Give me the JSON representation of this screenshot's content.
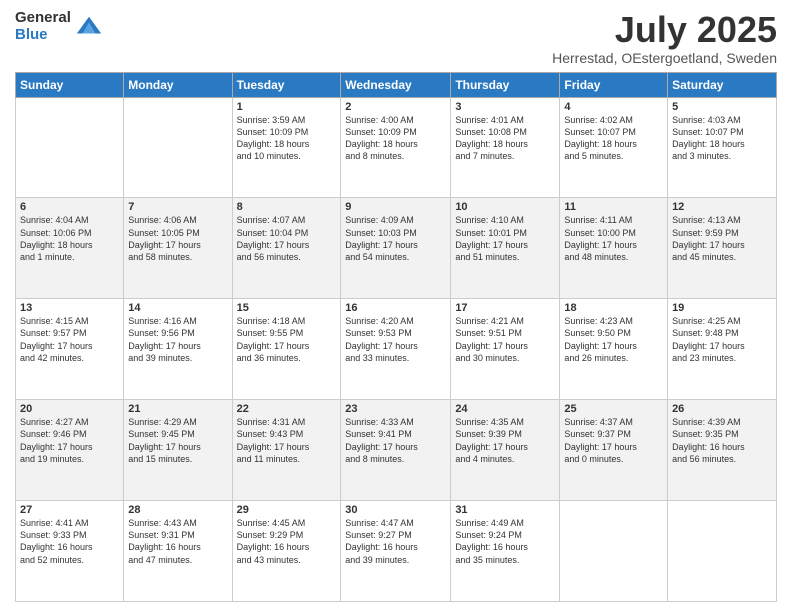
{
  "header": {
    "logo_general": "General",
    "logo_blue": "Blue",
    "title": "July 2025",
    "subtitle": "Herrestad, OEstergoetland, Sweden"
  },
  "days_of_week": [
    "Sunday",
    "Monday",
    "Tuesday",
    "Wednesday",
    "Thursday",
    "Friday",
    "Saturday"
  ],
  "weeks": [
    [
      {
        "day": "",
        "info": ""
      },
      {
        "day": "",
        "info": ""
      },
      {
        "day": "1",
        "info": "Sunrise: 3:59 AM\nSunset: 10:09 PM\nDaylight: 18 hours\nand 10 minutes."
      },
      {
        "day": "2",
        "info": "Sunrise: 4:00 AM\nSunset: 10:09 PM\nDaylight: 18 hours\nand 8 minutes."
      },
      {
        "day": "3",
        "info": "Sunrise: 4:01 AM\nSunset: 10:08 PM\nDaylight: 18 hours\nand 7 minutes."
      },
      {
        "day": "4",
        "info": "Sunrise: 4:02 AM\nSunset: 10:07 PM\nDaylight: 18 hours\nand 5 minutes."
      },
      {
        "day": "5",
        "info": "Sunrise: 4:03 AM\nSunset: 10:07 PM\nDaylight: 18 hours\nand 3 minutes."
      }
    ],
    [
      {
        "day": "6",
        "info": "Sunrise: 4:04 AM\nSunset: 10:06 PM\nDaylight: 18 hours\nand 1 minute."
      },
      {
        "day": "7",
        "info": "Sunrise: 4:06 AM\nSunset: 10:05 PM\nDaylight: 17 hours\nand 58 minutes."
      },
      {
        "day": "8",
        "info": "Sunrise: 4:07 AM\nSunset: 10:04 PM\nDaylight: 17 hours\nand 56 minutes."
      },
      {
        "day": "9",
        "info": "Sunrise: 4:09 AM\nSunset: 10:03 PM\nDaylight: 17 hours\nand 54 minutes."
      },
      {
        "day": "10",
        "info": "Sunrise: 4:10 AM\nSunset: 10:01 PM\nDaylight: 17 hours\nand 51 minutes."
      },
      {
        "day": "11",
        "info": "Sunrise: 4:11 AM\nSunset: 10:00 PM\nDaylight: 17 hours\nand 48 minutes."
      },
      {
        "day": "12",
        "info": "Sunrise: 4:13 AM\nSunset: 9:59 PM\nDaylight: 17 hours\nand 45 minutes."
      }
    ],
    [
      {
        "day": "13",
        "info": "Sunrise: 4:15 AM\nSunset: 9:57 PM\nDaylight: 17 hours\nand 42 minutes."
      },
      {
        "day": "14",
        "info": "Sunrise: 4:16 AM\nSunset: 9:56 PM\nDaylight: 17 hours\nand 39 minutes."
      },
      {
        "day": "15",
        "info": "Sunrise: 4:18 AM\nSunset: 9:55 PM\nDaylight: 17 hours\nand 36 minutes."
      },
      {
        "day": "16",
        "info": "Sunrise: 4:20 AM\nSunset: 9:53 PM\nDaylight: 17 hours\nand 33 minutes."
      },
      {
        "day": "17",
        "info": "Sunrise: 4:21 AM\nSunset: 9:51 PM\nDaylight: 17 hours\nand 30 minutes."
      },
      {
        "day": "18",
        "info": "Sunrise: 4:23 AM\nSunset: 9:50 PM\nDaylight: 17 hours\nand 26 minutes."
      },
      {
        "day": "19",
        "info": "Sunrise: 4:25 AM\nSunset: 9:48 PM\nDaylight: 17 hours\nand 23 minutes."
      }
    ],
    [
      {
        "day": "20",
        "info": "Sunrise: 4:27 AM\nSunset: 9:46 PM\nDaylight: 17 hours\nand 19 minutes."
      },
      {
        "day": "21",
        "info": "Sunrise: 4:29 AM\nSunset: 9:45 PM\nDaylight: 17 hours\nand 15 minutes."
      },
      {
        "day": "22",
        "info": "Sunrise: 4:31 AM\nSunset: 9:43 PM\nDaylight: 17 hours\nand 11 minutes."
      },
      {
        "day": "23",
        "info": "Sunrise: 4:33 AM\nSunset: 9:41 PM\nDaylight: 17 hours\nand 8 minutes."
      },
      {
        "day": "24",
        "info": "Sunrise: 4:35 AM\nSunset: 9:39 PM\nDaylight: 17 hours\nand 4 minutes."
      },
      {
        "day": "25",
        "info": "Sunrise: 4:37 AM\nSunset: 9:37 PM\nDaylight: 17 hours\nand 0 minutes."
      },
      {
        "day": "26",
        "info": "Sunrise: 4:39 AM\nSunset: 9:35 PM\nDaylight: 16 hours\nand 56 minutes."
      }
    ],
    [
      {
        "day": "27",
        "info": "Sunrise: 4:41 AM\nSunset: 9:33 PM\nDaylight: 16 hours\nand 52 minutes."
      },
      {
        "day": "28",
        "info": "Sunrise: 4:43 AM\nSunset: 9:31 PM\nDaylight: 16 hours\nand 47 minutes."
      },
      {
        "day": "29",
        "info": "Sunrise: 4:45 AM\nSunset: 9:29 PM\nDaylight: 16 hours\nand 43 minutes."
      },
      {
        "day": "30",
        "info": "Sunrise: 4:47 AM\nSunset: 9:27 PM\nDaylight: 16 hours\nand 39 minutes."
      },
      {
        "day": "31",
        "info": "Sunrise: 4:49 AM\nSunset: 9:24 PM\nDaylight: 16 hours\nand 35 minutes."
      },
      {
        "day": "",
        "info": ""
      },
      {
        "day": "",
        "info": ""
      }
    ]
  ]
}
